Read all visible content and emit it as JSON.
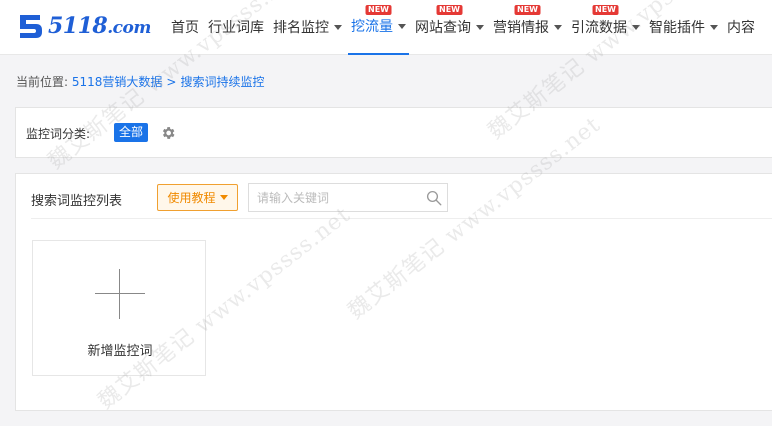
{
  "logo": {
    "brand": "5118",
    "domain": ".com"
  },
  "nav": [
    {
      "label": "首页",
      "caret": false,
      "badge": ""
    },
    {
      "label": "行业词库",
      "caret": false,
      "badge": ""
    },
    {
      "label": "排名监控",
      "caret": true,
      "badge": ""
    },
    {
      "label": "挖流量",
      "caret": true,
      "badge": "NEW",
      "active": true
    },
    {
      "label": "网站查询",
      "caret": true,
      "badge": "NEW"
    },
    {
      "label": "营销情报",
      "caret": true,
      "badge": "NEW"
    },
    {
      "label": "引流数据",
      "caret": true,
      "badge": "NEW"
    },
    {
      "label": "智能插件",
      "caret": true,
      "badge": ""
    },
    {
      "label": "内容",
      "caret": false,
      "badge": ""
    }
  ],
  "breadcrumb": {
    "prefix": "当前位置:",
    "items": [
      "5118营销大数据",
      "搜索词持续监控"
    ],
    "sep": ">"
  },
  "filter": {
    "label": "监控词分类:",
    "tag": "全部"
  },
  "list": {
    "title": "搜索词监控列表",
    "tutorial": "使用教程",
    "search_placeholder": "请输入关键词",
    "add_label": "新增监控词"
  },
  "watermark": "魏艾斯笔记 www.vpssss.net",
  "colors": {
    "accent": "#1a73e8",
    "badge": "#e53935",
    "tutorial": "#f08a00"
  }
}
